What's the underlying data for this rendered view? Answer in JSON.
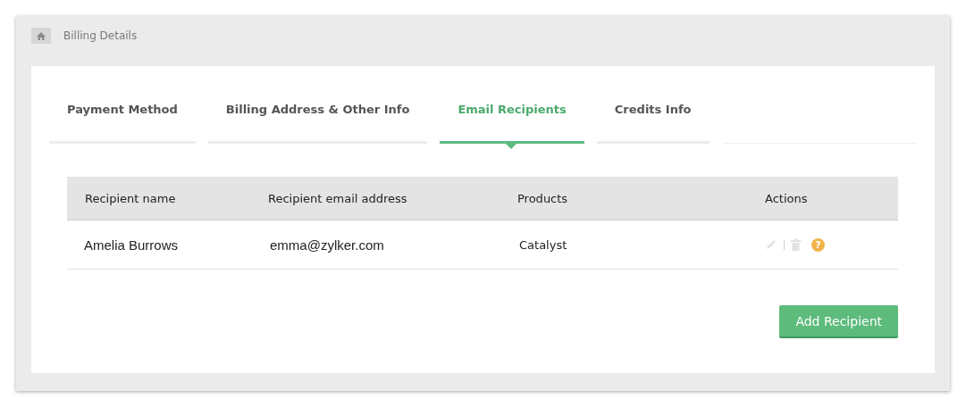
{
  "breadcrumb": {
    "title": "Billing Details"
  },
  "tabs": [
    {
      "label": "Payment Method",
      "selected": false
    },
    {
      "label": "Billing Address & Other Info",
      "selected": false
    },
    {
      "label": "Email Recipients",
      "selected": true
    },
    {
      "label": "Credits Info",
      "selected": false
    }
  ],
  "table": {
    "columns": [
      "Recipient name",
      "Recipient email address",
      "Products",
      "Actions"
    ],
    "rows": [
      {
        "name": "Amelia Burrows",
        "email": "emma@zylker.com",
        "products": "Catalyst",
        "edit_disabled": true,
        "delete_disabled": true,
        "help": "?"
      }
    ]
  },
  "buttons": [
    "Add Recipient"
  ]
}
